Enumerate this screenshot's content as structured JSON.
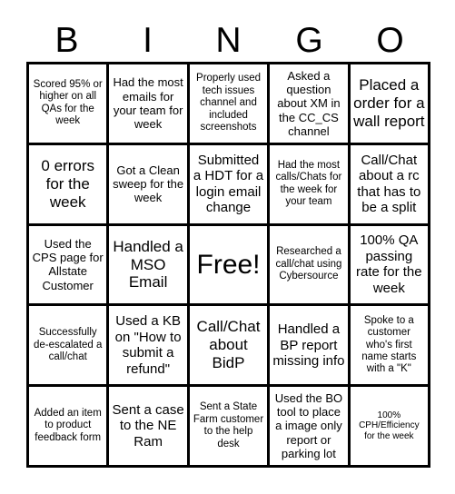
{
  "card": {
    "title_letters": [
      "B",
      "I",
      "N",
      "G",
      "O"
    ],
    "rows": [
      [
        "Scored 95% or higher on all QAs for the week",
        "Had the most emails for your team for week",
        "Properly used tech issues channel and included screenshots",
        "Asked a question about XM in the CC_CS channel",
        "Placed a order for a wall report"
      ],
      [
        "0 errors for the week",
        "Got a Clean sweep for the week",
        "Submitted a HDT for a login email change",
        "Had the most calls/Chats for the week for your team",
        "Call/Chat about a rc that has to be a split"
      ],
      [
        "Used the CPS page for Allstate Customer",
        "Handled a MSO Email",
        "Free!",
        "Researched a call/chat using Cybersource",
        "100% QA passing rate for the week"
      ],
      [
        "Successfully de-escalated a call/chat",
        "Used a KB on \"How to submit a refund\"",
        "Call/Chat about BidP",
        "Handled a BP report missing info",
        "Spoke to a customer who's first name starts with a \"K\""
      ],
      [
        "Added an item to product feedback form",
        "Sent a case to the NE Ram",
        "Sent a State Farm customer to the help desk",
        "Used the BO tool to place a image only report or parking lot",
        "100% CPH/Efficiency for the week"
      ]
    ],
    "free_space": {
      "row": 2,
      "col": 2,
      "label": "Free!"
    },
    "colors": {
      "background": "#ffffff",
      "text": "#000000",
      "border": "#000000"
    }
  }
}
